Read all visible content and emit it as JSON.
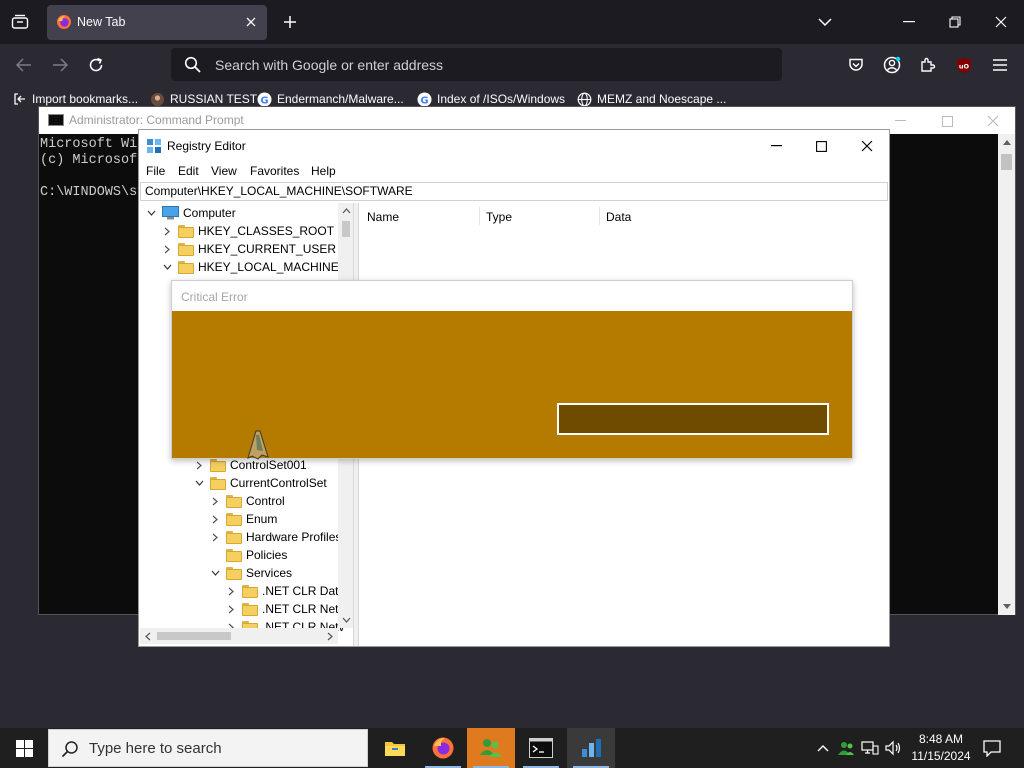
{
  "browser": {
    "tab": {
      "title": "New Tab"
    },
    "urlbar": {
      "placeholder": "Search with Google or enter address"
    },
    "bookmarks": [
      {
        "label": "Import bookmarks...",
        "icon": "import-icon"
      },
      {
        "label": "RUSSIAN TEST",
        "icon": "generic-site-icon"
      },
      {
        "label": "Endermanch/Malware...",
        "icon": "google-icon"
      },
      {
        "label": "Index of /ISOs/Windows",
        "icon": "google-icon"
      },
      {
        "label": "MEMZ and Noescape ...",
        "icon": "globe-icon"
      }
    ],
    "colors": {
      "tabbar": "#1c1b22",
      "toolbar": "#2b2a33",
      "tab": "#42414d"
    }
  },
  "cmd": {
    "title": "Administrator: Command Prompt",
    "lines": [
      "Microsoft Wi",
      "(c) Microsof",
      "",
      "C:\\WINDOWS\\sy"
    ]
  },
  "regedit": {
    "title": "Registry Editor",
    "menu": [
      "File",
      "Edit",
      "View",
      "Favorites",
      "Help"
    ],
    "address": "Computer\\HKEY_LOCAL_MACHINE\\SOFTWARE",
    "columns": [
      "Name",
      "Type",
      "Data"
    ],
    "tree": [
      {
        "label": "Computer",
        "expanded": true
      },
      {
        "label": "HKEY_CLASSES_ROOT",
        "expanded": false
      },
      {
        "label": "HKEY_CURRENT_USER",
        "expanded": false
      },
      {
        "label": "HKEY_LOCAL_MACHINE",
        "expanded": true
      },
      {
        "label": "ControlSet001",
        "expanded": false
      },
      {
        "label": "CurrentControlSet",
        "expanded": true
      },
      {
        "label": "Control",
        "expanded": false
      },
      {
        "label": "Enum",
        "expanded": false
      },
      {
        "label": "Hardware Profiles",
        "expanded": false
      },
      {
        "label": "Policies",
        "expanded": false
      },
      {
        "label": "Services",
        "expanded": true
      },
      {
        "label": ".NET CLR Data",
        "expanded": false
      },
      {
        "label": ".NET CLR Netv",
        "expanded": false
      },
      {
        "label": ".NET CLR Netv",
        "expanded": false
      }
    ]
  },
  "critical_error": {
    "title": "Critical Error",
    "colors": {
      "body": "#b47b00",
      "button": "#6f4b00"
    }
  },
  "taskbar": {
    "search_placeholder": "Type here to search",
    "apps": [
      "file-explorer-icon",
      "firefox-icon",
      "people-icon",
      "command-prompt-icon",
      "registry-editor-icon"
    ],
    "time": "8:48 AM",
    "date": "11/15/2024"
  }
}
